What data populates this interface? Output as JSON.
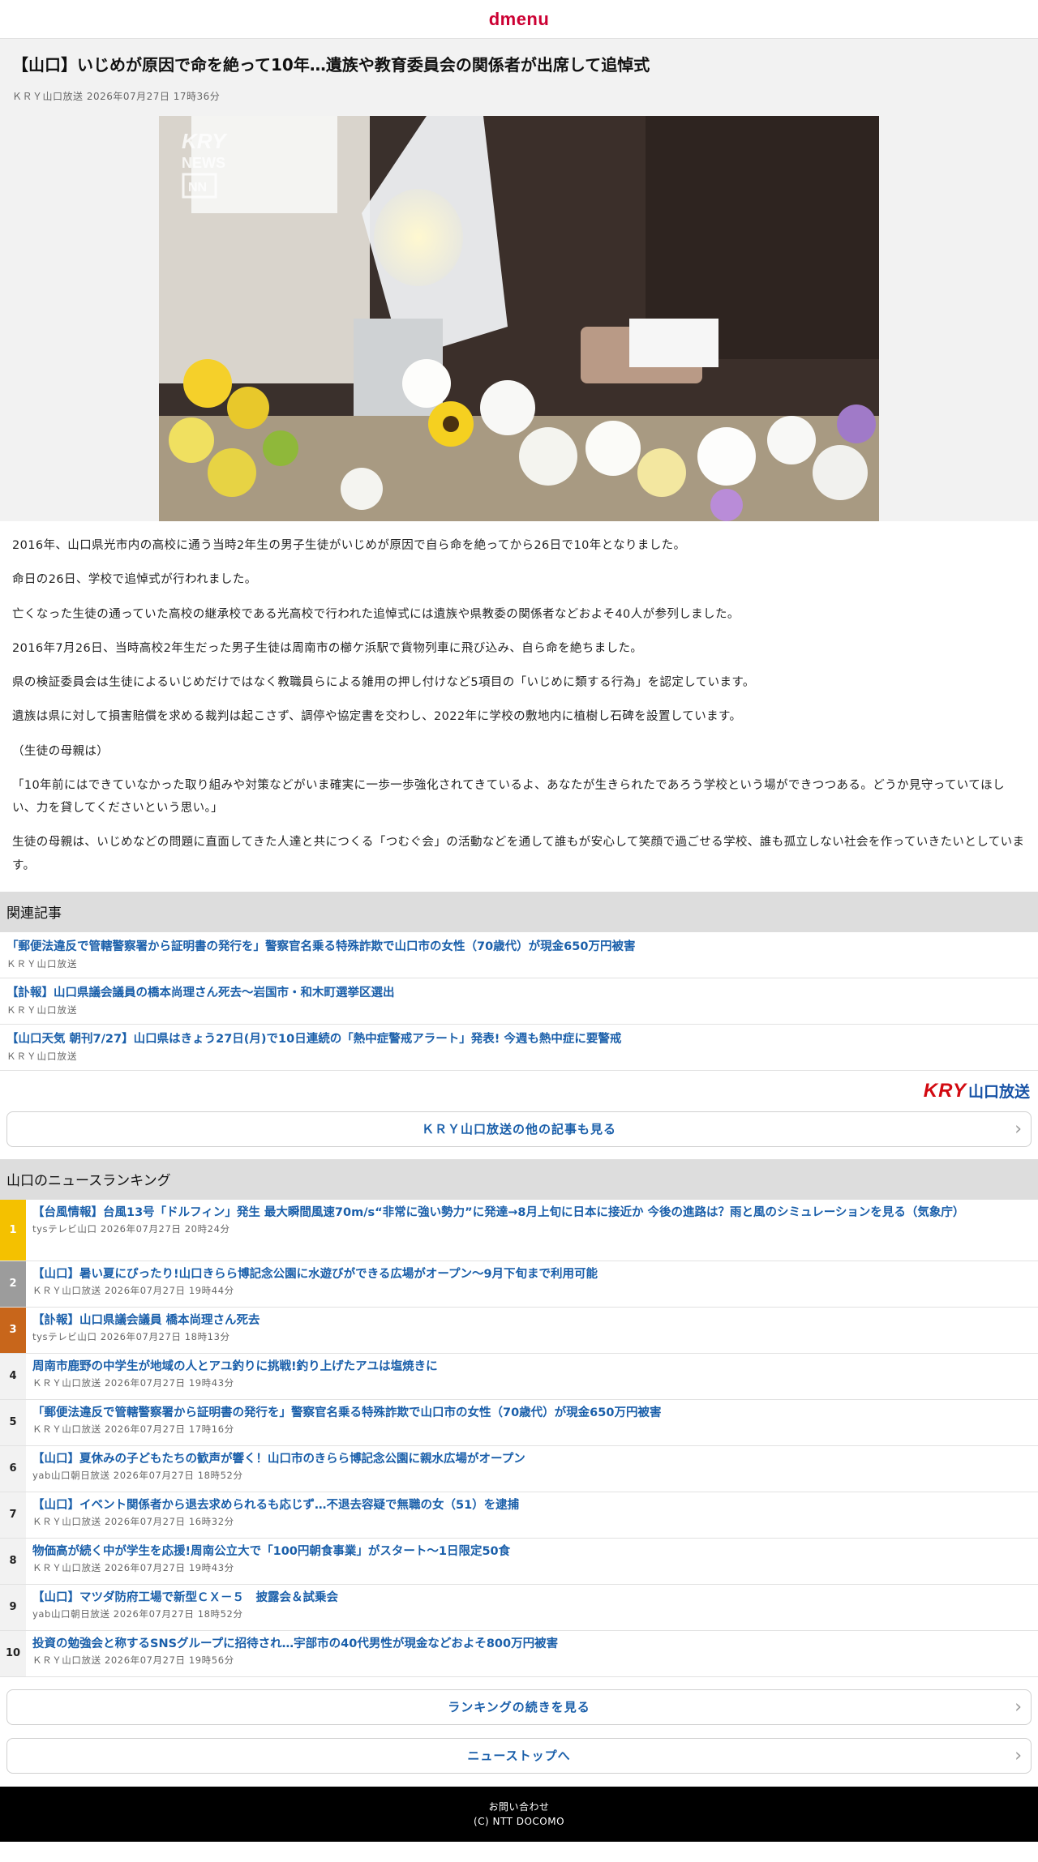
{
  "header": {
    "logo": "dmenu"
  },
  "article": {
    "title": "【山口】いじめが原因で命を絶って10年…遺族や教育委員会の関係者が出席して追悼式",
    "meta": "ＫＲＹ山口放送 2026年07月27日 17時36分",
    "photo_watermark": "KRY NEWS NNN",
    "paragraphs": [
      "2016年、山口県光市内の高校に通う当時2年生の男子生徒がいじめが原因で自ら命を絶ってから26日で10年となりました。",
      "命日の26日、学校で追悼式が行われました。",
      "亡くなった生徒の通っていた高校の継承校である光高校で行われた追悼式には遺族や県教委の関係者などおよそ40人が参列しました。",
      "2016年7月26日、当時高校2年生だった男子生徒は周南市の櫛ケ浜駅で貨物列車に飛び込み、自ら命を絶ちました。",
      "県の検証委員会は生徒によるいじめだけではなく教職員らによる雑用の押し付けなど5項目の「いじめに類する行為」を認定しています。",
      "遺族は県に対して損害賠償を求める裁判は起こさず、調停や協定書を交わし、2022年に学校の敷地内に植樹し石碑を設置しています。",
      "（生徒の母親は）",
      "「10年前にはできていなかった取り組みや対策などがいま確実に一歩一歩強化されてきているよ、あなたが生きられたであろう学校という場ができつつある。どうか見守っていてほしい、力を貸してくださいという思い。」",
      "生徒の母親は、いじめなどの問題に直面してきた人達と共につくる「つむぐ会」の活動などを通して誰もが安心して笑顔で過ごせる学校、誰も孤立しない社会を作っていきたいとしています。"
    ]
  },
  "related": {
    "heading": "関連記事",
    "items": [
      {
        "title": "「郵便法違反で管轄警察署から証明書の発行を」警察官名乗る特殊詐欺で山口市の女性（70歳代）が現金650万円被害",
        "source": "ＫＲＹ山口放送"
      },
      {
        "title": "【訃報】山口県議会議員の橋本尚理さん死去〜岩国市・和木町選挙区選出",
        "source": "ＫＲＹ山口放送"
      },
      {
        "title": "【山口天気 朝刊7/27】山口県はきょう27日(月)で10日連続の「熱中症警戒アラート」発表! 今週も熱中症に要警戒",
        "source": "ＫＲＹ山口放送"
      }
    ]
  },
  "provider": {
    "logo_mark": "KRY",
    "logo_text": "山口放送",
    "more_label": "ＫＲＹ山口放送の他の記事も見る"
  },
  "ranking": {
    "heading": "山口のニュースランキング",
    "items": [
      {
        "rank": "1",
        "title": "【台風情報】台風13号「ドルフィン」発生 最大瞬間風速70m/s“非常に強い勢力”に発達→8月上旬に日本に接近か 今後の進路は？雨と風のシミュレーションを見る（気象庁）",
        "meta": "tysテレビ山口 2026年07月27日 20時24分"
      },
      {
        "rank": "2",
        "title": "【山口】暑い夏にぴったり!山口きらら博記念公園に水遊びができる広場がオープン〜9月下旬まで利用可能",
        "meta": "ＫＲＹ山口放送 2026年07月27日 19時44分"
      },
      {
        "rank": "3",
        "title": "【訃報】山口県議会議員 橋本尚理さん死去",
        "meta": "tysテレビ山口 2026年07月27日 18時13分"
      },
      {
        "rank": "4",
        "title": "周南市鹿野の中学生が地域の人とアユ釣りに挑戦!釣り上げたアユは塩焼きに",
        "meta": "ＫＲＹ山口放送 2026年07月27日 19時43分"
      },
      {
        "rank": "5",
        "title": "「郵便法違反で管轄警察署から証明書の発行を」警察官名乗る特殊詐欺で山口市の女性（70歳代）が現金650万円被害",
        "meta": "ＫＲＹ山口放送 2026年07月27日 17時16分"
      },
      {
        "rank": "6",
        "title": "【山口】夏休みの子どもたちの歓声が響く！山口市のきらら博記念公園に親水広場がオープン",
        "meta": "yab山口朝日放送 2026年07月27日 18時52分"
      },
      {
        "rank": "7",
        "title": "【山口】イベント関係者から退去求められるも応じず…不退去容疑で無職の女（51）を逮捕",
        "meta": "ＫＲＹ山口放送 2026年07月27日 16時32分"
      },
      {
        "rank": "8",
        "title": "物価高が続く中が学生を応援!周南公立大で「100円朝食事業」がスタート〜1日限定50食",
        "meta": "ＫＲＹ山口放送 2026年07月27日 19時43分"
      },
      {
        "rank": "9",
        "title": "【山口】マツダ防府工場で新型ＣＸ－５　披露会＆試乗会",
        "meta": "yab山口朝日放送 2026年07月27日 18時52分"
      },
      {
        "rank": "10",
        "title": "投資の勉強会と称するSNSグループに招待され…宇部市の40代男性が現金などおよそ800万円被害",
        "meta": "ＫＲＹ山口放送 2026年07月27日 19時56分"
      }
    ],
    "more_label": "ランキングの続きを見る",
    "top_label": "ニューストップへ"
  },
  "footer": {
    "contact": "お問い合わせ",
    "copyright": "(C) NTT DOCOMO"
  },
  "icons": {
    "chevron": "chevron-right-icon"
  },
  "colors": {
    "brand": "#cc0033",
    "link": "#1a5faa",
    "rank1": "#f4c100",
    "rank2": "#9c9c9c",
    "rank3": "#c8661b"
  }
}
